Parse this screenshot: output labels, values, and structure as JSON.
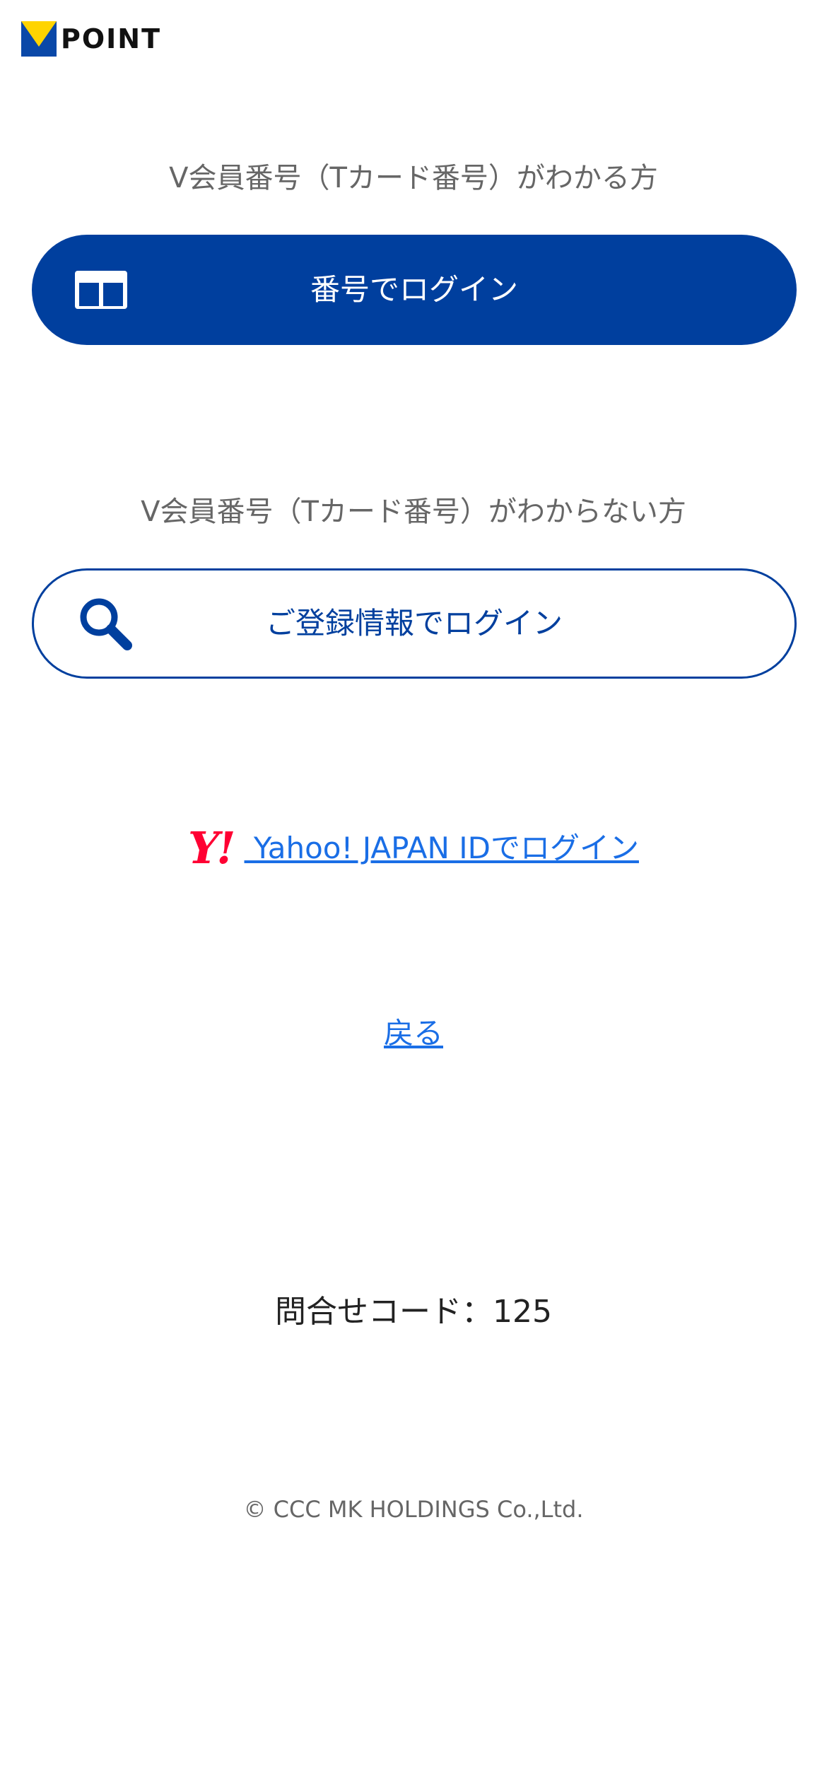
{
  "header": {
    "logo_text": "POINT",
    "logo_icon": "v-logo-icon"
  },
  "known_section": {
    "label": "V会員番号（Tカード番号）がわかる方",
    "button_label": "番号でログイン",
    "button_icon": "card-icon"
  },
  "unknown_section": {
    "label": "V会員番号（Tカード番号）がわからない方",
    "button_label": "ご登録情報でログイン",
    "button_icon": "search-icon"
  },
  "yahoo": {
    "logo_text": "Y!",
    "link_label": " Yahoo! JAPAN IDでログイン"
  },
  "back_link": "戻る",
  "inquiry_code": "問合せコード：125",
  "copyright": "© CCC MK HOLDINGS Co.,Ltd.",
  "colors": {
    "brand_blue": "#003f9e",
    "logo_yellow": "#ffd400",
    "link_blue": "#1a6ee6",
    "yahoo_red": "#ff0033"
  }
}
